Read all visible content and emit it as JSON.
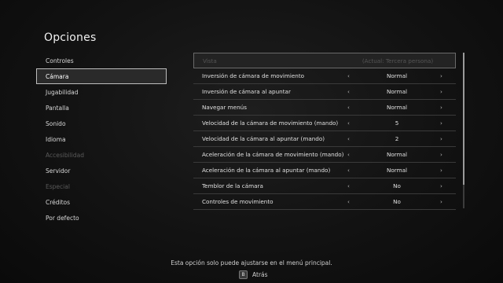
{
  "header": {
    "title": "Opciones"
  },
  "sidebar": {
    "items": [
      {
        "label": "Controles",
        "state": "normal"
      },
      {
        "label": "Cámara",
        "state": "active"
      },
      {
        "label": "Jugabilidad",
        "state": "normal"
      },
      {
        "label": "Pantalla",
        "state": "normal"
      },
      {
        "label": "Sonido",
        "state": "normal"
      },
      {
        "label": "Idioma",
        "state": "normal"
      },
      {
        "label": "Accesibilidad",
        "state": "disabled"
      },
      {
        "label": "Servidor",
        "state": "normal"
      },
      {
        "label": "Especial",
        "state": "disabled"
      },
      {
        "label": "Créditos",
        "state": "normal"
      },
      {
        "label": "Por defecto",
        "state": "normal"
      }
    ]
  },
  "settings": {
    "rows": [
      {
        "label": "Vista",
        "value": "(Actual: Tercera persona)",
        "state": "disabled"
      },
      {
        "label": "Inversión de cámara de movimiento",
        "value": "Normal",
        "state": "normal"
      },
      {
        "label": "Inversión de cámara al apuntar",
        "value": "Normal",
        "state": "normal"
      },
      {
        "label": "Navegar menús",
        "value": "Normal",
        "state": "normal"
      },
      {
        "label": "Velocidad de la cámara de movimiento (mando)",
        "value": "5",
        "state": "normal"
      },
      {
        "label": "Velocidad de la cámara al apuntar (mando)",
        "value": "2",
        "state": "normal"
      },
      {
        "label": "Aceleración de la cámara de movimiento (mando)",
        "value": "Normal",
        "state": "normal"
      },
      {
        "label": "Aceleración de la cámara al apuntar (mando)",
        "value": "Normal",
        "state": "normal"
      },
      {
        "label": "Temblor de la cámara",
        "value": "No",
        "state": "normal"
      },
      {
        "label": "Controles de movimiento",
        "value": "No",
        "state": "normal"
      }
    ],
    "arrow_left": "‹",
    "arrow_right": "›"
  },
  "footer": {
    "hint": "Esta opción solo puede ajustarse en el menú principal.",
    "back_button_glyph": "B",
    "back_label": "Atrás"
  }
}
